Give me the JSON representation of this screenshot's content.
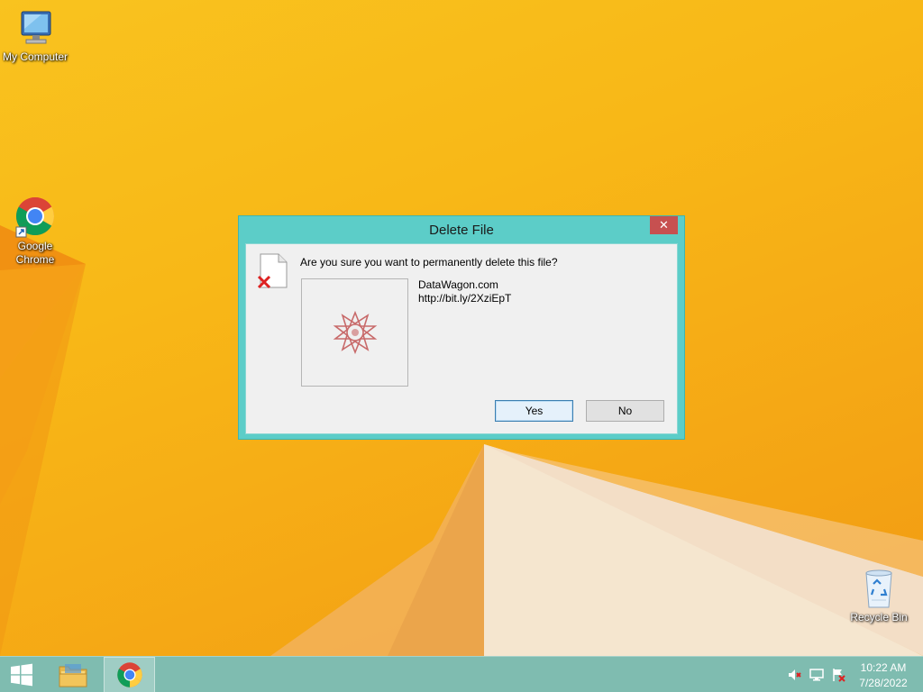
{
  "desktop": {
    "icons": [
      {
        "label": "My Computer",
        "icon": "computer-icon"
      },
      {
        "label": "Google Chrome",
        "icon": "chrome-icon"
      },
      {
        "label": "Recycle Bin",
        "icon": "recycle-bin-icon"
      }
    ]
  },
  "dialog": {
    "title": "Delete File",
    "close_label": "✕",
    "question": "Are you sure you want to permanently delete this file?",
    "file_name": "DataWagon.com",
    "file_url": "http://bit.ly/2XziEpT",
    "yes_label": "Yes",
    "no_label": "No",
    "colors": {
      "frame": "#5ccdc8",
      "close": "#c75050",
      "body": "#f0f0f0"
    }
  },
  "taskbar": {
    "items": [
      {
        "name": "start",
        "icon": "windows-logo-icon"
      },
      {
        "name": "file-explorer",
        "icon": "folder-icon"
      },
      {
        "name": "chrome",
        "icon": "chrome-icon"
      }
    ],
    "tray": [
      "volume-muted-icon",
      "network-icon",
      "action-center-icon"
    ],
    "clock": {
      "time": "10:22 AM",
      "date": "7/28/2022"
    }
  }
}
